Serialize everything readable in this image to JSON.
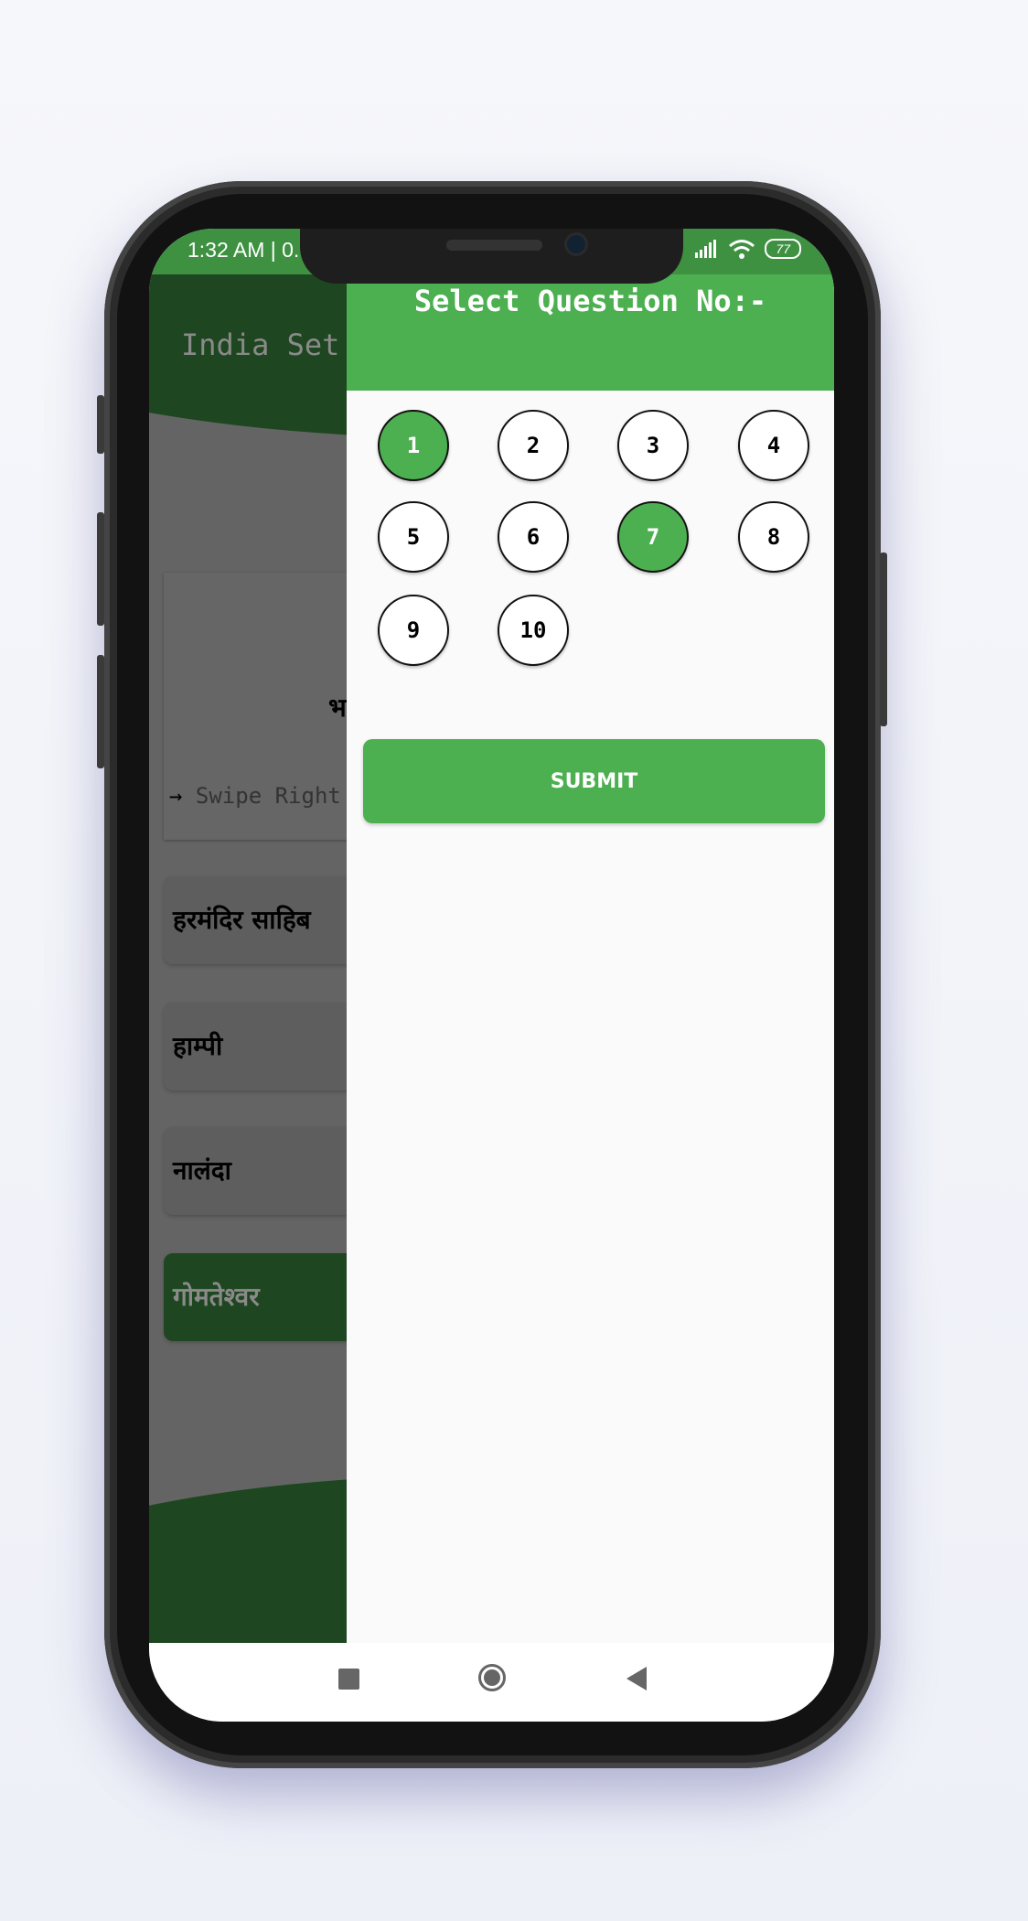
{
  "status_bar": {
    "time": "1:32 AM | 0.",
    "battery": "77"
  },
  "app": {
    "title": "India Set",
    "question_partial": "भा",
    "swipe_hint": "Swipe Right",
    "options": [
      {
        "label": "हरमंदिर साहिब",
        "selected": false
      },
      {
        "label": "हाम्पी",
        "selected": false
      },
      {
        "label": "नालंदा",
        "selected": false
      },
      {
        "label": "गोमतेश्वर",
        "selected": true
      }
    ]
  },
  "drawer": {
    "title": "Select Question No:-",
    "questions": [
      {
        "n": "1",
        "answered": true
      },
      {
        "n": "2",
        "answered": false
      },
      {
        "n": "3",
        "answered": false
      },
      {
        "n": "4",
        "answered": false
      },
      {
        "n": "5",
        "answered": false
      },
      {
        "n": "6",
        "answered": false
      },
      {
        "n": "7",
        "answered": true
      },
      {
        "n": "8",
        "answered": false
      },
      {
        "n": "9",
        "answered": false
      },
      {
        "n": "10",
        "answered": false
      }
    ],
    "submit_label": "SUBMIT"
  },
  "colors": {
    "accent": "#4caf50",
    "status_bar": "#3f9142"
  },
  "icons": {
    "nav": [
      "recents-square-icon",
      "home-circle-icon",
      "back-triangle-icon"
    ]
  }
}
